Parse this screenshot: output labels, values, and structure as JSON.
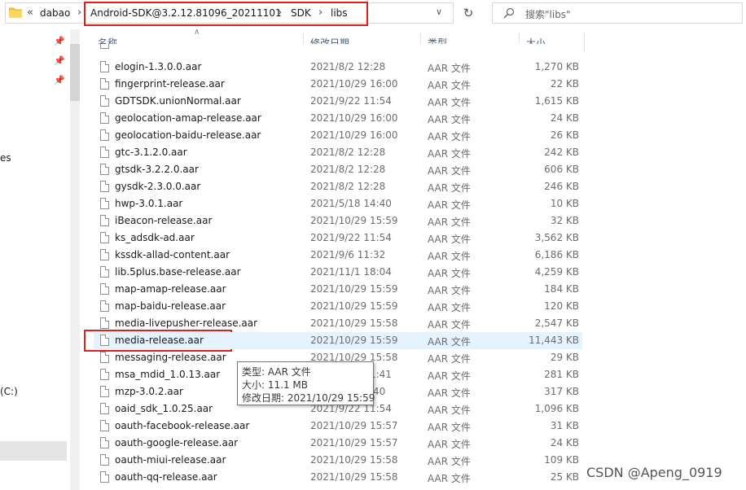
{
  "address": {
    "crumbs_overflow": "«",
    "parent": "dabao",
    "path": [
      "Android-SDK@3.2.12.81096_20211101",
      "SDK",
      "libs"
    ]
  },
  "search": {
    "placeholder": "搜索\"libs\""
  },
  "nav": {
    "fragments": [
      "es",
      "(C:)"
    ]
  },
  "columns": {
    "name": "名称",
    "date": "修改日期",
    "type": "类型",
    "size": "大小"
  },
  "files": [
    {
      "name": "elogin-1.3.0.0.aar",
      "date": "2021/8/2 12:28",
      "type": "AAR 文件",
      "size": "1,270 KB"
    },
    {
      "name": "fingerprint-release.aar",
      "date": "2021/10/29 16:00",
      "type": "AAR 文件",
      "size": "22 KB"
    },
    {
      "name": "GDTSDK.unionNormal.aar",
      "date": "2021/9/22 11:54",
      "type": "AAR 文件",
      "size": "1,615 KB"
    },
    {
      "name": "geolocation-amap-release.aar",
      "date": "2021/10/29 16:00",
      "type": "AAR 文件",
      "size": "24 KB"
    },
    {
      "name": "geolocation-baidu-release.aar",
      "date": "2021/10/29 16:00",
      "type": "AAR 文件",
      "size": "26 KB"
    },
    {
      "name": "gtc-3.1.2.0.aar",
      "date": "2021/8/2 12:28",
      "type": "AAR 文件",
      "size": "242 KB"
    },
    {
      "name": "gtsdk-3.2.2.0.aar",
      "date": "2021/8/2 12:28",
      "type": "AAR 文件",
      "size": "606 KB"
    },
    {
      "name": "gysdk-2.3.0.0.aar",
      "date": "2021/8/2 12:28",
      "type": "AAR 文件",
      "size": "246 KB"
    },
    {
      "name": "hwp-3.0.1.aar",
      "date": "2021/5/18 14:40",
      "type": "AAR 文件",
      "size": "10 KB"
    },
    {
      "name": "iBeacon-release.aar",
      "date": "2021/10/29 15:59",
      "type": "AAR 文件",
      "size": "32 KB"
    },
    {
      "name": "ks_adsdk-ad.aar",
      "date": "2021/9/22 11:54",
      "type": "AAR 文件",
      "size": "3,562 KB"
    },
    {
      "name": "kssdk-allad-content.aar",
      "date": "2021/9/6 11:32",
      "type": "AAR 文件",
      "size": "6,186 KB"
    },
    {
      "name": "lib.5plus.base-release.aar",
      "date": "2021/11/1 18:04",
      "type": "AAR 文件",
      "size": "4,259 KB"
    },
    {
      "name": "map-amap-release.aar",
      "date": "2021/10/29 15:59",
      "type": "AAR 文件",
      "size": "184 KB"
    },
    {
      "name": "map-baidu-release.aar",
      "date": "2021/10/29 15:59",
      "type": "AAR 文件",
      "size": "120 KB"
    },
    {
      "name": "media-livepusher-release.aar",
      "date": "2021/10/29 15:58",
      "type": "AAR 文件",
      "size": "2,547 KB"
    },
    {
      "name": "media-release.aar",
      "date": "2021/10/29 15:59",
      "type": "AAR 文件",
      "size": "11,443 KB",
      "selected": true
    },
    {
      "name": "messaging-release.aar",
      "date": "2021/10/29 15:58",
      "type": "AAR 文件",
      "size": "29 KB"
    },
    {
      "name": "msa_mdid_1.0.13.aar",
      "date": "2021/9/22 11:41",
      "type": "AAR 文件",
      "size": "281 KB"
    },
    {
      "name": "mzp-3.0.2.aar",
      "date": "2021/8/2 12:40",
      "type": "AAR 文件",
      "size": "317 KB"
    },
    {
      "name": "oaid_sdk_1.0.25.aar",
      "date": "2021/9/22 11:54",
      "type": "AAR 文件",
      "size": "1,096 KB"
    },
    {
      "name": "oauth-facebook-release.aar",
      "date": "2021/10/29 15:57",
      "type": "AAR 文件",
      "size": "31 KB"
    },
    {
      "name": "oauth-google-release.aar",
      "date": "2021/10/29 15:57",
      "type": "AAR 文件",
      "size": "24 KB"
    },
    {
      "name": "oauth-miui-release.aar",
      "date": "2021/10/29 15:58",
      "type": "AAR 文件",
      "size": "109 KB"
    },
    {
      "name": "oauth-qq-release.aar",
      "date": "2021/10/29 15:58",
      "type": "AAR 文件",
      "size": "25 KB"
    }
  ],
  "tooltip": {
    "type": "类型: AAR 文件",
    "size": "大小: 11.1 MB",
    "date": "修改日期: 2021/10/29 15:59"
  },
  "watermark": "CSDN @Apeng_0919"
}
